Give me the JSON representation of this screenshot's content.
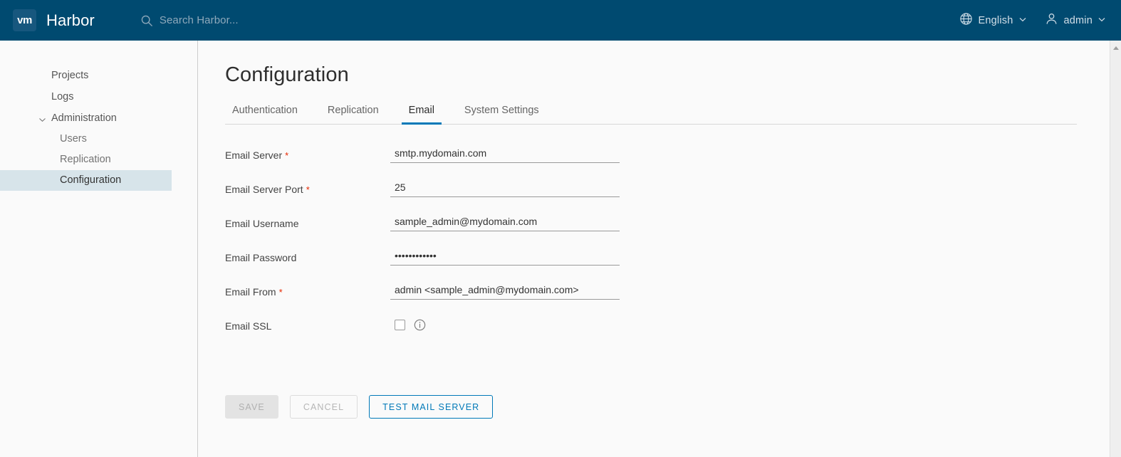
{
  "header": {
    "logo_text": "vm",
    "logo_icon": "vmware-logo-icon",
    "title": "Harbor",
    "search": {
      "icon": "search-icon",
      "placeholder": "Search Harbor..."
    },
    "language": {
      "icon": "globe-icon",
      "label": "English",
      "caret": "chevron-down-icon"
    },
    "user": {
      "icon": "user-icon",
      "label": "admin",
      "caret": "chevron-down-icon"
    },
    "background_color": "#004a70"
  },
  "sidebar": {
    "items": [
      {
        "label": "Projects",
        "type": "link",
        "active": false
      },
      {
        "label": "Logs",
        "type": "link",
        "active": false
      },
      {
        "label": "Administration",
        "type": "group",
        "active": false,
        "expanded": true
      }
    ],
    "sub_items": [
      {
        "label": "Users",
        "active": false
      },
      {
        "label": "Replication",
        "active": false
      },
      {
        "label": "Configuration",
        "active": true
      }
    ],
    "active_background": "#d7e4ea"
  },
  "main": {
    "page_title": "Configuration",
    "tabs": [
      {
        "label": "Authentication",
        "active": false
      },
      {
        "label": "Replication",
        "active": false
      },
      {
        "label": "Email",
        "active": true
      },
      {
        "label": "System Settings",
        "active": false
      }
    ],
    "active_tab_color": "#0079b8",
    "form": {
      "fields": [
        {
          "label": "Email Server",
          "required": true,
          "value": "smtp.mydomain.com",
          "type": "text"
        },
        {
          "label": "Email Server Port",
          "required": true,
          "value": "25",
          "type": "text"
        },
        {
          "label": "Email Username",
          "required": false,
          "value": "sample_admin@mydomain.com",
          "type": "text"
        },
        {
          "label": "Email Password",
          "required": false,
          "value": "••••••••••••",
          "type": "password"
        },
        {
          "label": "Email From",
          "required": true,
          "value": "admin <sample_admin@mydomain.com>",
          "type": "text"
        }
      ],
      "ssl": {
        "label": "Email SSL",
        "checked": false,
        "info_icon": "info-circle-icon"
      },
      "required_marker": "*",
      "required_color": "#e62700"
    },
    "buttons": [
      {
        "label": "SAVE",
        "style": "disabled-filled"
      },
      {
        "label": "CANCEL",
        "style": "disabled-outline"
      },
      {
        "label": "TEST MAIL SERVER",
        "style": "primary-outline"
      }
    ]
  },
  "scrollbar": {
    "up_arrow_icon": "caret-up-icon"
  }
}
